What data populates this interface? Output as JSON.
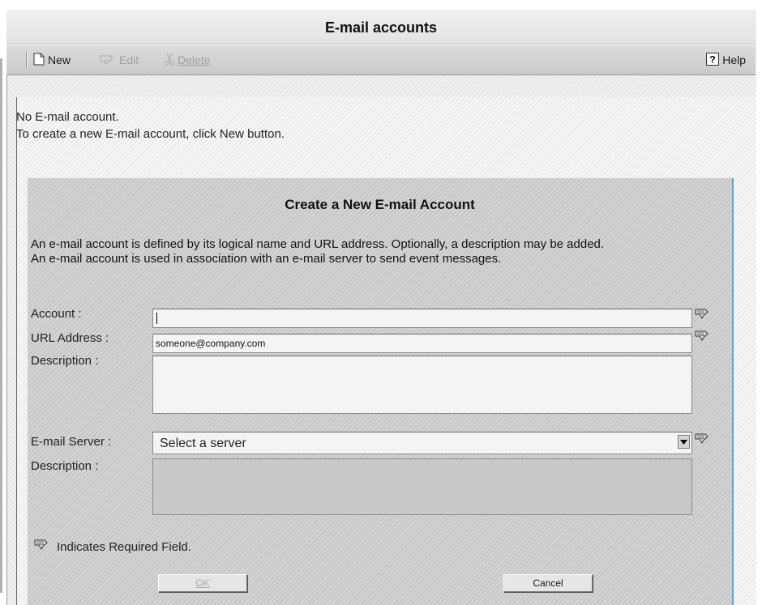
{
  "window": {
    "title": "E-mail accounts"
  },
  "toolbar": {
    "new_label": "New",
    "edit_label": "Edit",
    "delete_label": "Delete",
    "help_label": "Help",
    "new_icon": "new-document-icon",
    "edit_icon": "edit-icon",
    "delete_icon": "scissors-icon",
    "help_icon": "question-icon"
  },
  "messages": {
    "no_account": "No E-mail account.",
    "instruction": "To create a new E-mail account, click New button."
  },
  "form": {
    "title": "Create a New E-mail Account",
    "intro_line1": "An e-mail account is defined by its logical name and URL address. Optionally, a description may be added.",
    "intro_line2": "An e-mail account is used in association with an e-mail server to send event messages.",
    "account_label": "Account :",
    "account_value": "",
    "url_label": "URL Address :",
    "url_value": "someone@company.com",
    "description_label": "Description :",
    "description_value": "",
    "server_label": "E-mail Server :",
    "server_selected": "Select a server",
    "server_description_label": "Description :",
    "server_description_value": "",
    "required_note": "Indicates Required Field.",
    "ok_label": "OK",
    "cancel_label": "Cancel"
  },
  "colors": {
    "panel_border_accent": "#5da3d9",
    "panel_bg": "#c9c9c9"
  }
}
